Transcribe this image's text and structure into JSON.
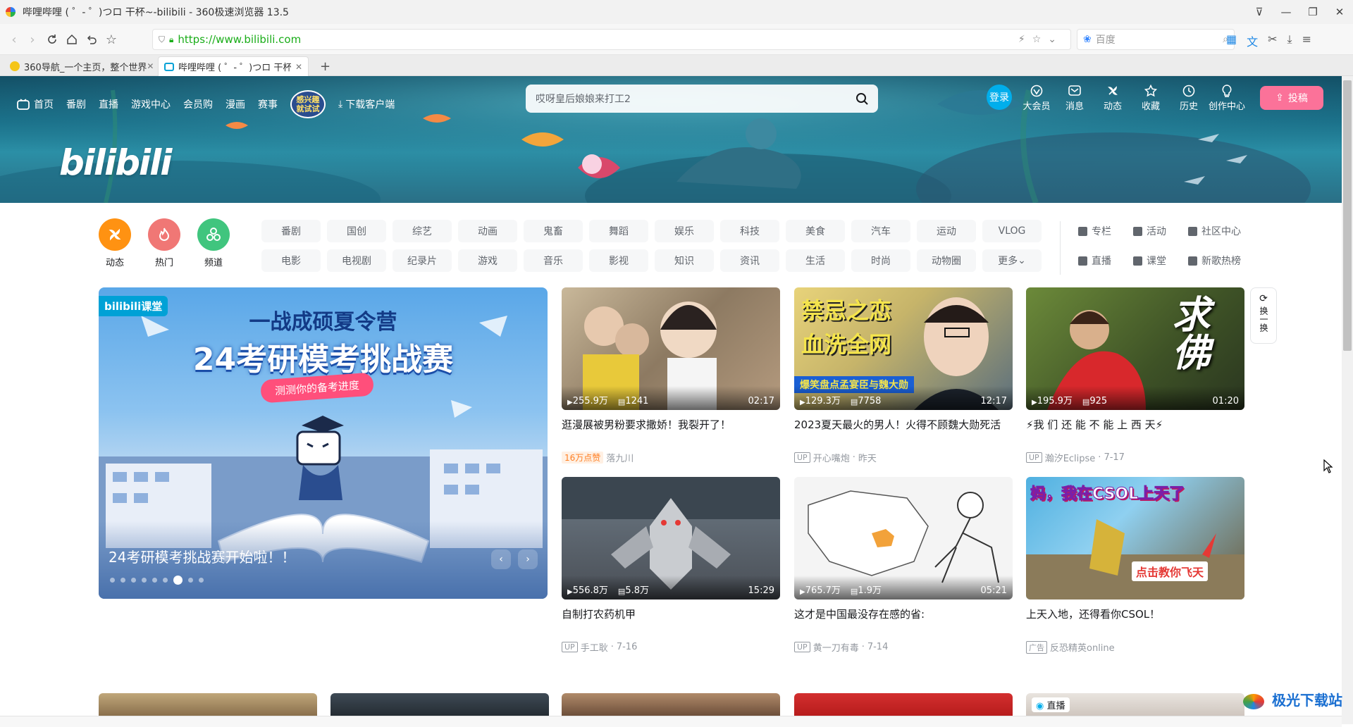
{
  "browser": {
    "window_title": "哔哩哔哩 ( ゜- ゜)つロ 干杯~-bilibili - 360极速浏览器 13.5",
    "url": "https://www.bilibili.com",
    "search_placeholder": "百度",
    "tabs": [
      {
        "label": "360导航_一个主页，整个世界"
      },
      {
        "label": "哔哩哔哩 ( ゜- ゜)つロ 干杯~-..."
      }
    ],
    "new_tab": "+"
  },
  "header": {
    "nav": [
      "首页",
      "番剧",
      "直播",
      "游戏中心",
      "会员购",
      "漫画",
      "赛事"
    ],
    "promo_label": "感兴趣就试试",
    "download": "下载客户端",
    "search_placeholder": "哎呀皇后娘娘来打工2",
    "login": "登录",
    "right_nav": [
      "大会员",
      "消息",
      "动态",
      "收藏",
      "历史",
      "创作中心"
    ],
    "upload": "投稿",
    "logo_text": "bilibili"
  },
  "channels": {
    "big": [
      "动态",
      "热门",
      "频道"
    ],
    "row1": [
      "番剧",
      "国创",
      "综艺",
      "动画",
      "鬼畜",
      "舞蹈",
      "娱乐",
      "科技",
      "美食",
      "汽车",
      "运动",
      "VLOG"
    ],
    "row2": [
      "电影",
      "电视剧",
      "纪录片",
      "游戏",
      "音乐",
      "影视",
      "知识",
      "资讯",
      "生活",
      "时尚",
      "动物圈",
      "更多"
    ],
    "right1": [
      "专栏",
      "活动",
      "社区中心"
    ],
    "right2": [
      "直播",
      "课堂",
      "新歌热榜"
    ]
  },
  "carousel": {
    "badge": "bilibili课堂",
    "headline1": "一战成硕夏令营",
    "headline2": "24考研模考挑战赛",
    "pill": "测测你的备考进度",
    "caption": "24考研模考挑战赛开始啦！！",
    "active_slide": 6,
    "slide_count": 9
  },
  "refresh": {
    "label": "换一换"
  },
  "videos": [
    {
      "title": "逛漫展被男粉要求撒娇！我裂开了！",
      "views": "255.9万",
      "danmaku": "1241",
      "duration": "02:17",
      "tag": "16万点赞",
      "author": "落九川",
      "date": ""
    },
    {
      "title": "2023夏天最火的男人！火得不顾魏大勋死活",
      "views": "129.3万",
      "danmaku": "7758",
      "duration": "12:17",
      "author": "开心嘴炮",
      "date": "昨天",
      "thumb_text1": "禁忌之恋",
      "thumb_text2": "血洗全网",
      "thumb_text3": "爆笑盘点孟宴臣与魏大勋"
    },
    {
      "title": "⚡我 们 还 能 不 能 上 西 天⚡",
      "views": "195.9万",
      "danmaku": "925",
      "duration": "01:20",
      "author": "瀚汐Eclipse",
      "date": "7-17",
      "thumb_text1": "求佛"
    },
    {
      "title": "自制打农药机甲",
      "views": "556.8万",
      "danmaku": "5.8万",
      "duration": "15:29",
      "author": "手工耿",
      "date": "7-16"
    },
    {
      "title": "这才是中国最没存在感的省:",
      "views": "765.7万",
      "danmaku": "1.9万",
      "duration": "05:21",
      "author": "黄一刀有毒",
      "date": "7-14"
    },
    {
      "title": "上天入地，还得看你CSOL！",
      "views": "",
      "danmaku": "",
      "duration": "",
      "ad": "广告",
      "author": "反恐精英online",
      "date": "",
      "thumb_text1": "妈，我在CSOL上天了",
      "thumb_text2": "点击教你飞天"
    }
  ],
  "bottom_row": {
    "live_badge": "直播"
  },
  "watermark": "极光下载站",
  "colors": {
    "pink": "#fb7299",
    "blue": "#00aeec",
    "text": "#18191c",
    "grey": "#61666d"
  }
}
